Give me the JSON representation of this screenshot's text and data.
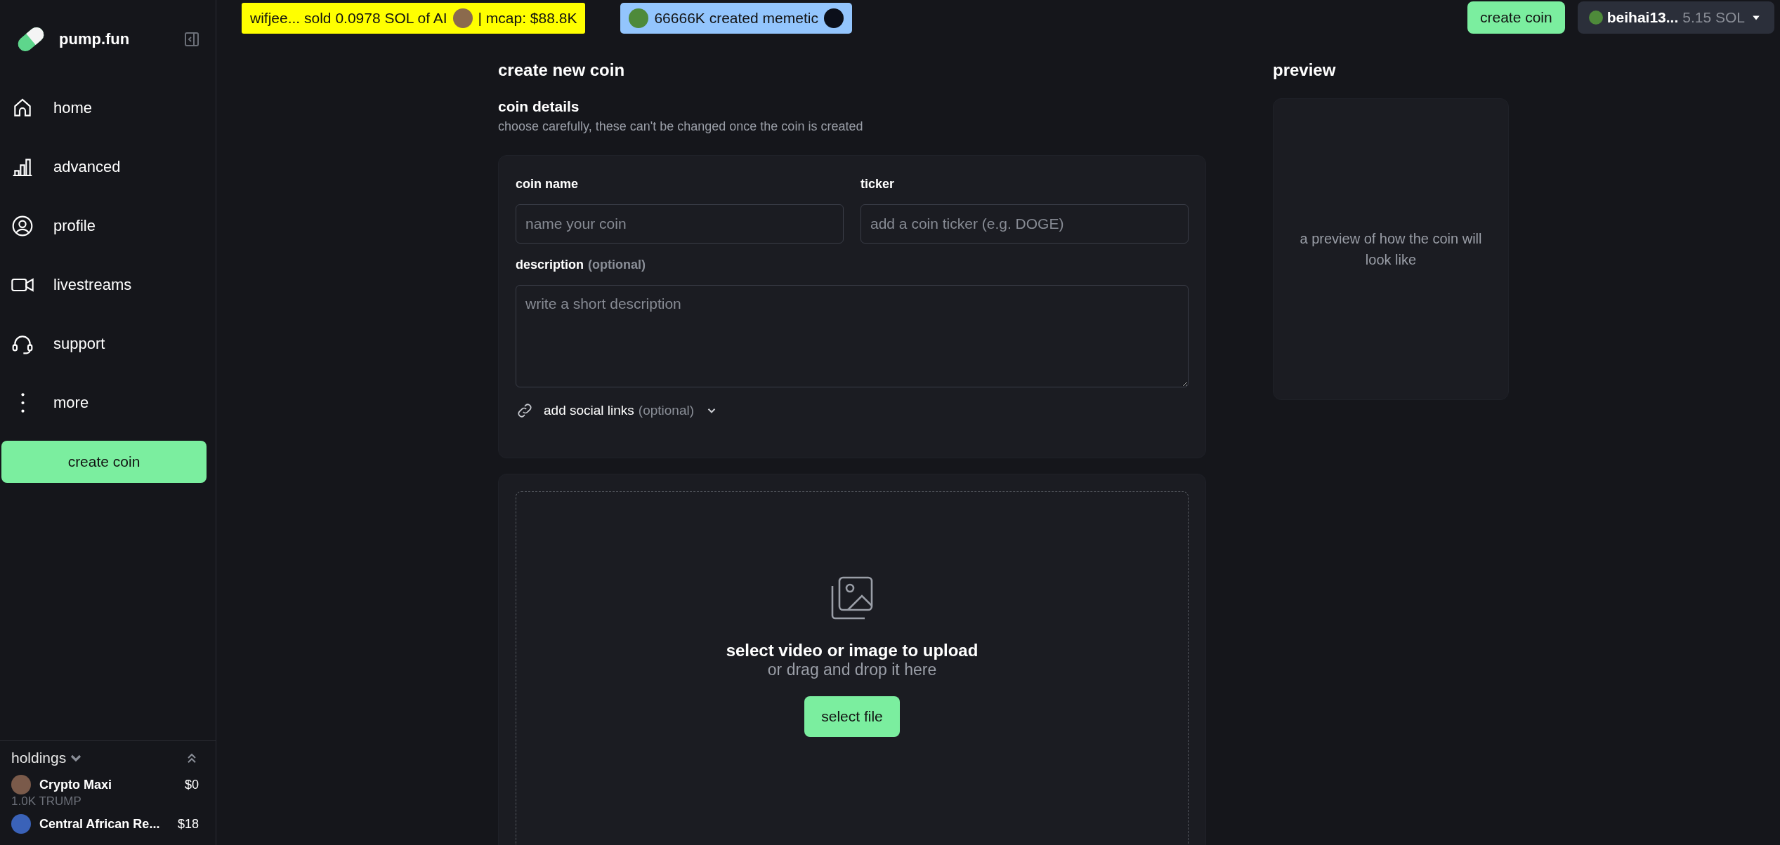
{
  "sidebar": {
    "brand": "pump.fun",
    "items": [
      {
        "label": "home",
        "kind": "home"
      },
      {
        "label": "advanced",
        "kind": "chart"
      },
      {
        "label": "profile",
        "kind": "profile"
      },
      {
        "label": "livestreams",
        "kind": "video"
      },
      {
        "label": "support",
        "kind": "support"
      },
      {
        "label": "more",
        "kind": "more"
      }
    ],
    "create_button": "create coin",
    "holdings": {
      "title": "holdings",
      "items": [
        {
          "name": "Crypto Maxi",
          "value": "$0",
          "amount": "1.0K TRUMP"
        },
        {
          "name": "Central African Re...",
          "value": "$18"
        }
      ]
    }
  },
  "ticker": [
    {
      "text": "wifjee... sold 0.0978 SOL of AI",
      "suffix": "| mcap: $88.8K",
      "kind": "sell"
    },
    {
      "text": "66666K created memetic",
      "kind": "create"
    }
  ],
  "header": {
    "create_button": "create coin",
    "wallet": {
      "name": "beihai13...",
      "balance": "5.15 SOL"
    }
  },
  "form": {
    "title": "create new coin",
    "section_title": "coin details",
    "section_note": "choose carefully, these can't be changed once the coin is created",
    "name_label": "coin name",
    "name_placeholder": "name your coin",
    "ticker_label": "ticker",
    "ticker_placeholder": "add a coin ticker (e.g. DOGE)",
    "description_label": "description",
    "description_hint": "(optional)",
    "description_placeholder": "write a short description",
    "social_label": "add social links",
    "social_hint": "(optional)"
  },
  "upload": {
    "title": "select video or image to upload",
    "subtitle": "or drag and drop it here",
    "button": "select file"
  },
  "preview": {
    "title": "preview",
    "text": "a preview of how the coin will look like"
  }
}
